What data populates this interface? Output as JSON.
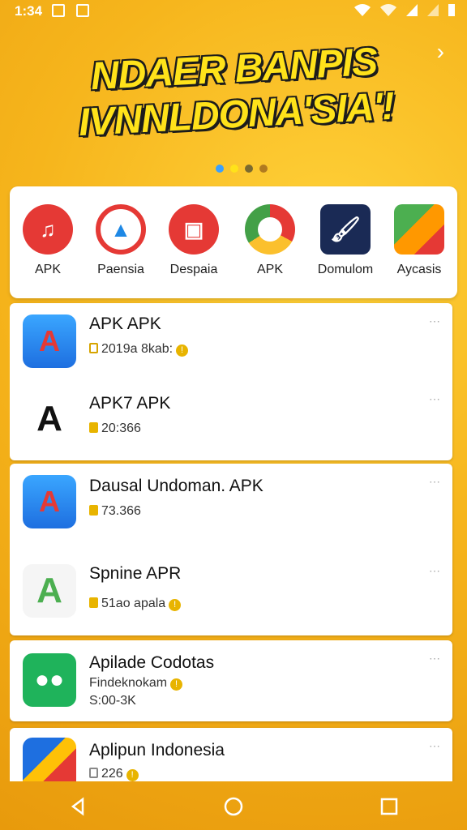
{
  "status_bar": {
    "time": "1:34",
    "icons": [
      "notification-icon",
      "app-icon",
      "wifi-icon",
      "wifi-icon",
      "signal-icon",
      "battery-icon"
    ]
  },
  "banner": {
    "title_line1": "NDAER BANPIS",
    "title_line2": "IVNNLDONA'SIA'!",
    "colors": {
      "title": "#ffe21a",
      "outline": "#1c1c1c"
    },
    "dots": [
      "#3aa0ff",
      "#ffe21a",
      "#7a6a30",
      "#b07a20"
    ]
  },
  "categories": [
    {
      "label": "APK",
      "icon": "music-note-icon",
      "color": "#e53935"
    },
    {
      "label": "Paensia",
      "icon": "triangle-arrow-icon",
      "color": "#e53935"
    },
    {
      "label": "Despaia",
      "icon": "grid-icon",
      "color": "#e53935"
    },
    {
      "label": "APK",
      "icon": "chrome-like-icon",
      "color": "#4caf50"
    },
    {
      "label": "Domulom",
      "icon": "paintbrush-icon",
      "color": "#1a2a55"
    },
    {
      "label": "Aycasis",
      "icon": "play-store-icon",
      "color": "#ff9800"
    }
  ],
  "apps": [
    {
      "name": "APK APK",
      "sub": "2019a 8kab:",
      "icon": "a-logo-icon"
    },
    {
      "name": "APK7 APK",
      "sub": "20:366",
      "icon": "a-black-logo-icon"
    },
    {
      "name": "Dausal Undoman. APK",
      "sub": "73.366",
      "icon": "a-logo-icon"
    },
    {
      "name": "Spnine APR",
      "sub": "51ao apala",
      "icon": "a-color-logo-icon"
    },
    {
      "name": "Apilade Codotas",
      "sub": "Findeknokam",
      "sub2": "S:00-3K",
      "icon": "chat-bubble-icon"
    },
    {
      "name": "Aplipun Indonesia",
      "sub": "226",
      "icon": "rainbow-app-icon"
    }
  ],
  "more_label": "⋯",
  "nav": [
    "back-icon",
    "home-icon",
    "recents-icon"
  ]
}
